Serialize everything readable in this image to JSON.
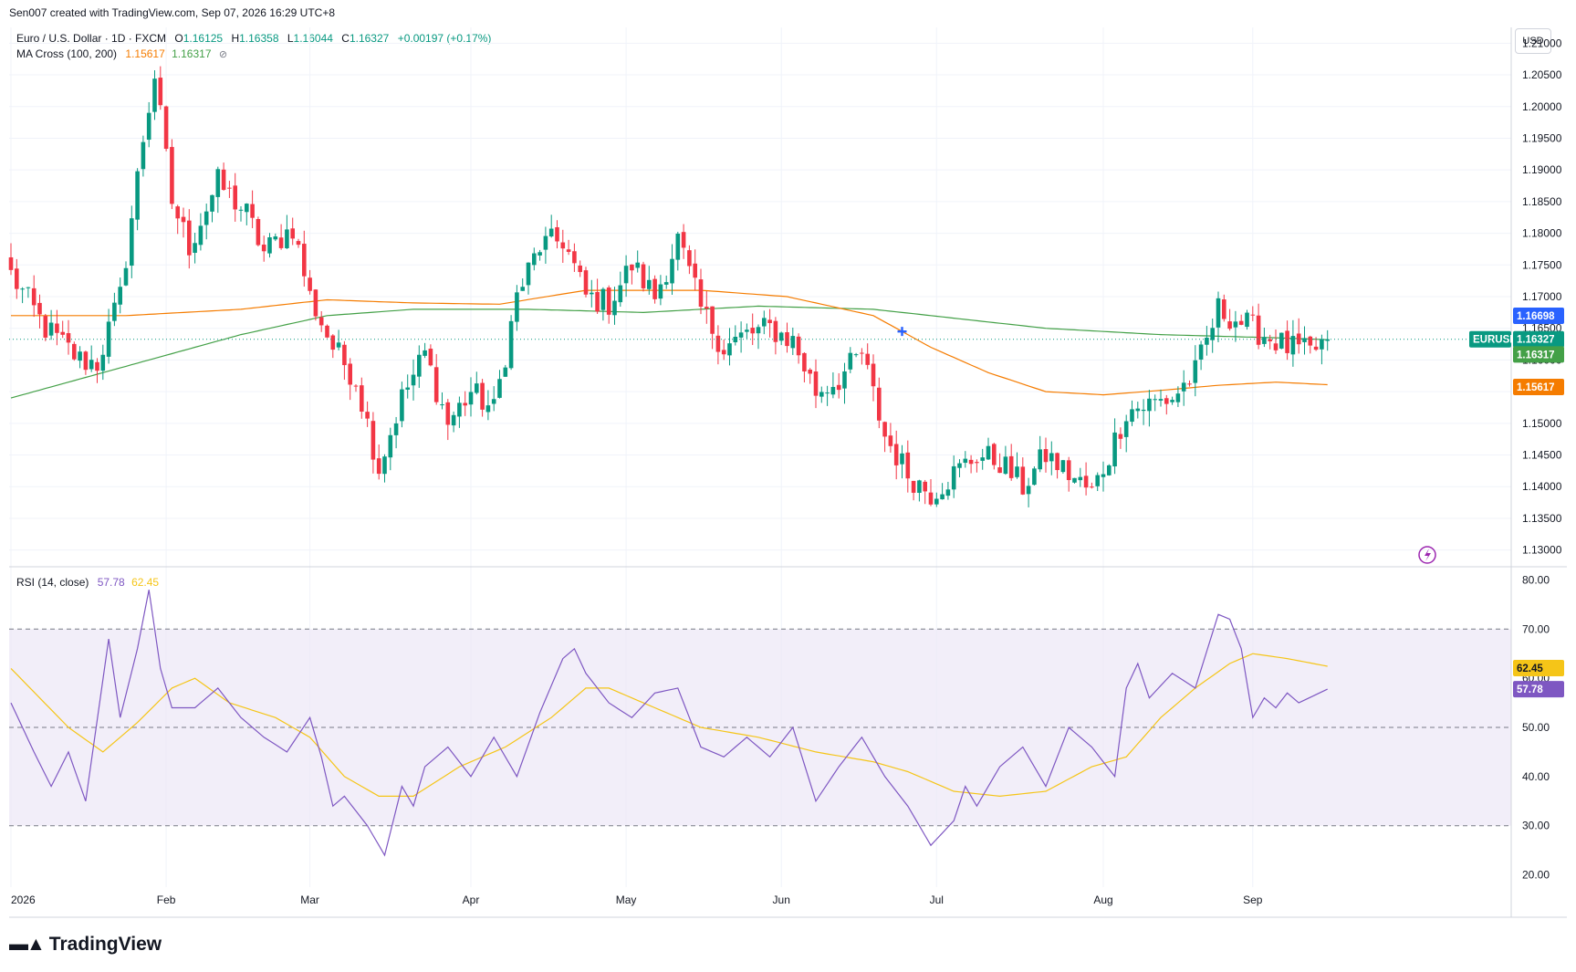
{
  "header": {
    "attribution": "Sen007 created with TradingView.com, Sep 07, 2026 16:29 UTC+8"
  },
  "legend": {
    "title": "Euro / U.S. Dollar · 1D · FXCM",
    "o_label": "O",
    "o_value": "1.16125",
    "h_label": "H",
    "h_value": "1.16358",
    "l_label": "L",
    "l_value": "1.16044",
    "c_label": "C",
    "c_value": "1.16327",
    "change": "+0.00197 (+0.17%)",
    "ma_title": "MA Cross (100, 200)",
    "ma_fast": "1.15617",
    "ma_slow": "1.16317",
    "ma_eye": "⊘",
    "rsi_title": "RSI (14, close)",
    "rsi_value": "57.78",
    "rsi_ma_value": "62.45"
  },
  "currency": "USD",
  "price_tags": {
    "symbol": "EURUSD",
    "last": "1.16327",
    "blue": "1.16698",
    "green": "1.16317",
    "orange": "1.15617",
    "rsi": "57.78",
    "rsi_ma": "62.45"
  },
  "logo_text": "TradingView",
  "colors": {
    "up": "#089981",
    "down": "#f23645",
    "ma100": "#f57c00",
    "ma200": "#43a047",
    "rsi": "#7e57c2",
    "rsi_ma": "#f5c518",
    "rsi_band": "#ede7f6",
    "cross_marker": "#2962ff"
  },
  "chart_data": [
    {
      "type": "candlestick",
      "symbol": "EURUSD",
      "interval": "1D",
      "ylim": [
        1.1275,
        1.2125
      ],
      "y_ticks": [
        "1.13000",
        "1.13500",
        "1.14000",
        "1.14500",
        "1.15000",
        "1.15500",
        "1.16000",
        "1.16500",
        "1.17000",
        "1.17500",
        "1.18000",
        "1.18500",
        "1.19000",
        "1.19500",
        "1.20000",
        "1.20500",
        "1.21000"
      ],
      "x_labels": [
        "2026",
        "Feb",
        "Mar",
        "Apr",
        "May",
        "Jun",
        "Jul",
        "Aug",
        "Sep"
      ],
      "close_waypoints": [
        [
          0,
          1.1735
        ],
        [
          6,
          1.165
        ],
        [
          12,
          1.16
        ],
        [
          15,
          1.1595
        ],
        [
          19,
          1.17
        ],
        [
          23,
          1.195
        ],
        [
          25,
          1.205
        ],
        [
          28,
          1.185
        ],
        [
          31,
          1.178
        ],
        [
          36,
          1.188
        ],
        [
          41,
          1.183
        ],
        [
          44,
          1.177
        ],
        [
          49,
          1.181
        ],
        [
          52,
          1.17
        ],
        [
          56,
          1.162
        ],
        [
          60,
          1.157
        ],
        [
          64,
          1.143
        ],
        [
          68,
          1.154
        ],
        [
          72,
          1.161
        ],
        [
          76,
          1.15
        ],
        [
          80,
          1.155
        ],
        [
          84,
          1.152
        ],
        [
          88,
          1.17
        ],
        [
          92,
          1.178
        ],
        [
          96,
          1.179
        ],
        [
          100,
          1.17
        ],
        [
          104,
          1.169
        ],
        [
          108,
          1.175
        ],
        [
          112,
          1.17
        ],
        [
          116,
          1.179
        ],
        [
          120,
          1.168
        ],
        [
          124,
          1.162
        ],
        [
          128,
          1.164
        ],
        [
          132,
          1.165
        ],
        [
          136,
          1.163
        ],
        [
          140,
          1.155
        ],
        [
          144,
          1.157
        ],
        [
          148,
          1.161
        ],
        [
          152,
          1.148
        ],
        [
          156,
          1.142
        ],
        [
          160,
          1.139
        ],
        [
          164,
          1.142
        ],
        [
          168,
          1.145
        ],
        [
          172,
          1.144
        ],
        [
          176,
          1.14
        ],
        [
          180,
          1.145
        ],
        [
          184,
          1.142
        ],
        [
          188,
          1.139
        ],
        [
          191,
          1.145
        ],
        [
          194,
          1.152
        ],
        [
          198,
          1.153
        ],
        [
          202,
          1.154
        ],
        [
          206,
          1.158
        ],
        [
          210,
          1.168
        ],
        [
          214,
          1.166
        ],
        [
          218,
          1.164
        ],
        [
          222,
          1.162
        ],
        [
          226,
          1.161
        ],
        [
          229,
          1.1633
        ]
      ],
      "ma100": [
        [
          0,
          1.167
        ],
        [
          20,
          1.167
        ],
        [
          40,
          1.168
        ],
        [
          55,
          1.1695
        ],
        [
          70,
          1.169
        ],
        [
          85,
          1.1688
        ],
        [
          100,
          1.171
        ],
        [
          120,
          1.171
        ],
        [
          135,
          1.17
        ],
        [
          150,
          1.167
        ],
        [
          160,
          1.162
        ],
        [
          170,
          1.158
        ],
        [
          180,
          1.155
        ],
        [
          190,
          1.1545
        ],
        [
          200,
          1.1552
        ],
        [
          210,
          1.156
        ],
        [
          220,
          1.1565
        ],
        [
          229,
          1.1561
        ]
      ],
      "ma200": [
        [
          0,
          1.154
        ],
        [
          20,
          1.159
        ],
        [
          40,
          1.164
        ],
        [
          55,
          1.167
        ],
        [
          70,
          1.168
        ],
        [
          90,
          1.168
        ],
        [
          110,
          1.1675
        ],
        [
          130,
          1.1685
        ],
        [
          150,
          1.168
        ],
        [
          165,
          1.1665
        ],
        [
          180,
          1.165
        ],
        [
          200,
          1.164
        ],
        [
          220,
          1.1635
        ],
        [
          229,
          1.1632
        ]
      ],
      "ma_cross_index": 155,
      "last_close": 1.16327
    },
    {
      "type": "line",
      "name": "RSI (14, close)",
      "ylim": [
        17.5,
        82.5
      ],
      "y_ticks": [
        "20.00",
        "30.00",
        "40.00",
        "50.00",
        "60.00",
        "70.00",
        "80.00"
      ],
      "band": [
        30,
        70
      ],
      "midline": 50,
      "rsi_waypoints": [
        [
          0,
          55
        ],
        [
          4,
          45
        ],
        [
          7,
          38
        ],
        [
          10,
          45
        ],
        [
          13,
          35
        ],
        [
          17,
          68
        ],
        [
          19,
          52
        ],
        [
          22,
          66
        ],
        [
          24,
          78
        ],
        [
          26,
          62
        ],
        [
          28,
          54
        ],
        [
          32,
          54
        ],
        [
          36,
          58
        ],
        [
          40,
          52
        ],
        [
          44,
          48
        ],
        [
          48,
          45
        ],
        [
          52,
          52
        ],
        [
          54,
          44
        ],
        [
          56,
          34
        ],
        [
          58,
          36
        ],
        [
          62,
          30
        ],
        [
          65,
          24
        ],
        [
          68,
          38
        ],
        [
          70,
          34
        ],
        [
          72,
          42
        ],
        [
          76,
          46
        ],
        [
          80,
          40
        ],
        [
          84,
          48
        ],
        [
          88,
          40
        ],
        [
          92,
          53
        ],
        [
          96,
          64
        ],
        [
          98,
          66
        ],
        [
          100,
          61
        ],
        [
          104,
          55
        ],
        [
          108,
          52
        ],
        [
          112,
          57
        ],
        [
          116,
          58
        ],
        [
          120,
          46
        ],
        [
          124,
          44
        ],
        [
          128,
          48
        ],
        [
          132,
          44
        ],
        [
          136,
          50
        ],
        [
          140,
          35
        ],
        [
          144,
          42
        ],
        [
          148,
          48
        ],
        [
          152,
          40
        ],
        [
          156,
          34
        ],
        [
          160,
          26
        ],
        [
          164,
          31
        ],
        [
          166,
          38
        ],
        [
          168,
          34
        ],
        [
          172,
          42
        ],
        [
          176,
          46
        ],
        [
          180,
          38
        ],
        [
          184,
          50
        ],
        [
          188,
          46
        ],
        [
          192,
          40
        ],
        [
          194,
          58
        ],
        [
          196,
          63
        ],
        [
          198,
          56
        ],
        [
          202,
          61
        ],
        [
          206,
          58
        ],
        [
          210,
          73
        ],
        [
          212,
          72
        ],
        [
          214,
          66
        ],
        [
          216,
          52
        ],
        [
          218,
          56
        ],
        [
          220,
          54
        ],
        [
          222,
          57
        ],
        [
          224,
          55
        ],
        [
          229,
          57.78
        ]
      ],
      "rsi_ma_waypoints": [
        [
          0,
          62
        ],
        [
          10,
          50
        ],
        [
          16,
          45
        ],
        [
          22,
          51
        ],
        [
          28,
          58
        ],
        [
          32,
          60
        ],
        [
          38,
          55
        ],
        [
          46,
          52
        ],
        [
          52,
          48
        ],
        [
          58,
          40
        ],
        [
          64,
          36
        ],
        [
          70,
          36
        ],
        [
          78,
          42
        ],
        [
          86,
          46
        ],
        [
          94,
          52
        ],
        [
          100,
          58
        ],
        [
          104,
          58
        ],
        [
          110,
          55
        ],
        [
          120,
          50
        ],
        [
          130,
          48
        ],
        [
          140,
          45
        ],
        [
          150,
          43
        ],
        [
          156,
          41
        ],
        [
          164,
          37
        ],
        [
          172,
          36
        ],
        [
          180,
          37
        ],
        [
          188,
          42
        ],
        [
          194,
          44
        ],
        [
          200,
          52
        ],
        [
          206,
          58
        ],
        [
          212,
          63
        ],
        [
          216,
          65
        ],
        [
          222,
          64
        ],
        [
          229,
          62.45
        ]
      ],
      "last_value": 57.78,
      "last_ma_value": 62.45
    }
  ]
}
